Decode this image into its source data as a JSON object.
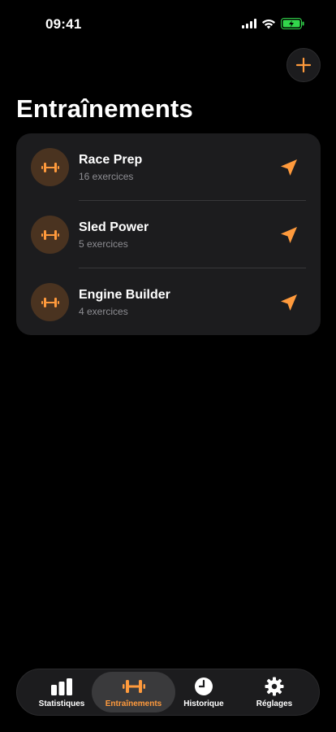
{
  "status_bar": {
    "time": "09:41"
  },
  "header": {
    "title": "Entraînements"
  },
  "colors": {
    "accent": "#ff9a3c",
    "background": "#000000",
    "card": "#1c1c1e",
    "avatar_bg": "#4a3320",
    "battery": "#32d74b"
  },
  "workouts": [
    {
      "name": "Race Prep",
      "subtitle": "16 exercices",
      "icon": "dumbbell-icon",
      "action_icon": "send-icon"
    },
    {
      "name": "Sled Power",
      "subtitle": "5 exercices",
      "icon": "dumbbell-icon",
      "action_icon": "send-icon"
    },
    {
      "name": "Engine Builder",
      "subtitle": "4 exercices",
      "icon": "dumbbell-icon",
      "action_icon": "send-icon"
    }
  ],
  "tab_bar": {
    "tabs": [
      {
        "label": "Statistiques",
        "icon": "bar-chart-icon",
        "active": false
      },
      {
        "label": "Entraînements",
        "icon": "dumbbell-icon",
        "active": true
      },
      {
        "label": "Historique",
        "icon": "clock-icon",
        "active": false
      },
      {
        "label": "Réglages",
        "icon": "gear-icon",
        "active": false
      }
    ]
  }
}
